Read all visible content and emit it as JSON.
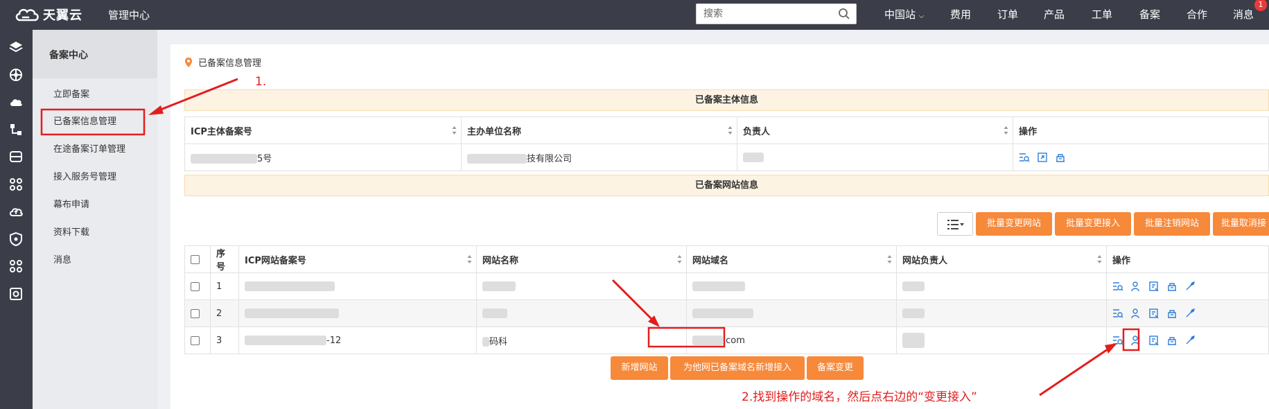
{
  "topbar": {
    "logo_text": "天翼云",
    "mgmt_center": "管理中心",
    "search_placeholder": "搜索",
    "nav": [
      "中国站",
      "费用",
      "订单",
      "产品",
      "工单",
      "备案",
      "合作",
      "消息"
    ],
    "message_badge": "1"
  },
  "sidebar": {
    "title": "备案中心",
    "items": [
      "立即备案",
      "已备案信息管理",
      "在途备案订单管理",
      "接入服务号管理",
      "幕布申请",
      "资料下载",
      "消息"
    ]
  },
  "breadcrumb": "已备案信息管理",
  "subject_section": {
    "title": "已备案主体信息",
    "headers": [
      "ICP主体备案号",
      "主办单位名称",
      "负责人",
      "操作"
    ],
    "row": {
      "icp_suffix": "5号",
      "org_suffix": "技有限公司"
    }
  },
  "site_section": {
    "title": "已备案网站信息",
    "batch_buttons": [
      "批量变更网站",
      "批量变更接入",
      "批量注销网站",
      "批量取消接"
    ],
    "headers": [
      "序号",
      "ICP网站备案号",
      "网站名称",
      "网站域名",
      "网站负责人",
      "操作"
    ],
    "rows": [
      {
        "no": "1",
        "icp_suffix": "",
        "name_suffix": "",
        "domain_suffix": ""
      },
      {
        "no": "2",
        "icp_suffix": "",
        "name_suffix": "",
        "domain_suffix": ""
      },
      {
        "no": "3",
        "icp_suffix": "-12",
        "name_suffix": "码科",
        "domain_suffix": ".com"
      }
    ],
    "bottom_buttons": [
      "新增网站",
      "为他网已备案域名新增接入",
      "备案变更"
    ]
  },
  "annotations": {
    "step1": "1.",
    "step2": "2.找到操作的域名，然后点右边的“变更接入”",
    "color": "#e31d1d"
  },
  "colors": {
    "accent": "#f7893b",
    "topbar": "#3b3e49",
    "icon_blue": "#2e7fd8"
  }
}
